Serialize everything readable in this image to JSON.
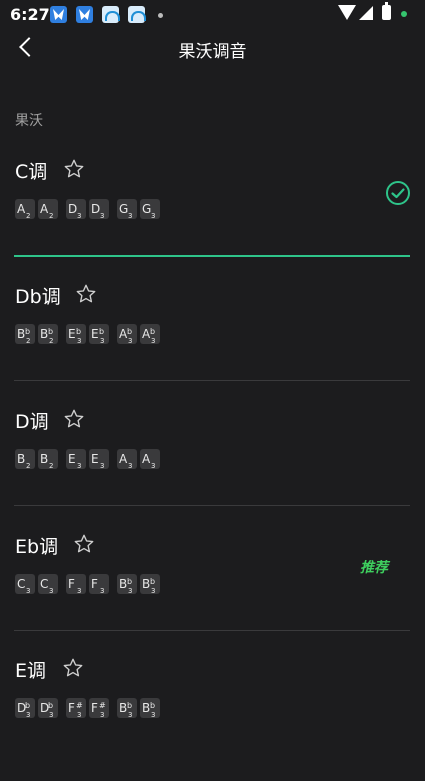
{
  "status_bar": {
    "time": "6:27",
    "notifications": [
      "bird-app-icon",
      "bird-app-icon",
      "circle-app-icon",
      "circle-app-icon"
    ]
  },
  "header": {
    "title": "果沃调音",
    "back_icon": "chevron-left-icon"
  },
  "section_label": "果沃",
  "accent_color": "#2ec48a",
  "tunings": [
    {
      "name": "C调",
      "selected": true,
      "notes": [
        {
          "l": "A",
          "a": "",
          "o": "2"
        },
        {
          "l": "A",
          "a": "",
          "o": "2"
        },
        {
          "l": "D",
          "a": "",
          "o": "3"
        },
        {
          "l": "D",
          "a": "",
          "o": "3"
        },
        {
          "l": "G",
          "a": "",
          "o": "3"
        },
        {
          "l": "G",
          "a": "",
          "o": "3"
        }
      ]
    },
    {
      "name": "Db调",
      "selected": false,
      "notes": [
        {
          "l": "B",
          "a": "b",
          "o": "2"
        },
        {
          "l": "B",
          "a": "b",
          "o": "2"
        },
        {
          "l": "E",
          "a": "b",
          "o": "3"
        },
        {
          "l": "E",
          "a": "b",
          "o": "3"
        },
        {
          "l": "A",
          "a": "b",
          "o": "3"
        },
        {
          "l": "A",
          "a": "b",
          "o": "3"
        }
      ]
    },
    {
      "name": "D调",
      "selected": false,
      "notes": [
        {
          "l": "B",
          "a": "",
          "o": "2"
        },
        {
          "l": "B",
          "a": "",
          "o": "2"
        },
        {
          "l": "E",
          "a": "",
          "o": "3"
        },
        {
          "l": "E",
          "a": "",
          "o": "3"
        },
        {
          "l": "A",
          "a": "",
          "o": "3"
        },
        {
          "l": "A",
          "a": "",
          "o": "3"
        }
      ]
    },
    {
      "name": "Eb调",
      "selected": false,
      "badge": "推荐",
      "notes": [
        {
          "l": "C",
          "a": "",
          "o": "3"
        },
        {
          "l": "C",
          "a": "",
          "o": "3"
        },
        {
          "l": "F",
          "a": "",
          "o": "3"
        },
        {
          "l": "F",
          "a": "",
          "o": "3"
        },
        {
          "l": "B",
          "a": "b",
          "o": "3"
        },
        {
          "l": "B",
          "a": "b",
          "o": "3"
        }
      ]
    },
    {
      "name": "E调",
      "selected": false,
      "notes": [
        {
          "l": "D",
          "a": "b",
          "o": "3"
        },
        {
          "l": "D",
          "a": "b",
          "o": "3"
        },
        {
          "l": "F",
          "a": "#",
          "o": "3"
        },
        {
          "l": "F",
          "a": "#",
          "o": "3"
        },
        {
          "l": "B",
          "a": "b",
          "o": "3"
        },
        {
          "l": "B",
          "a": "b",
          "o": "3"
        }
      ]
    }
  ]
}
